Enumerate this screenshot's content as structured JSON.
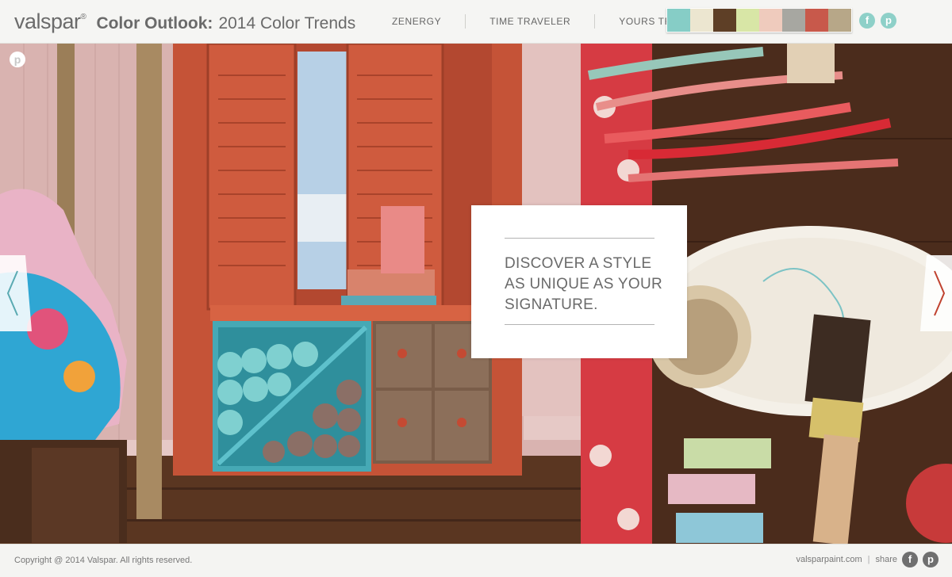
{
  "header": {
    "logo_brand": "valspar",
    "logo_mark": "®",
    "title_bold": "Color Outlook:",
    "title_light": "2014 Color Trends",
    "nav": [
      "ZENERGY",
      "TIME TRAVELER",
      "YOURS TRULY"
    ],
    "palette": [
      "#86cdc6",
      "#ece6d0",
      "#5e3f26",
      "#d8e6a6",
      "#efcbbd",
      "#a7a7a1",
      "#c8594b",
      "#b7a788"
    ],
    "social_icon_color": "#8ed0c8"
  },
  "hero": {
    "callout_text": "DISCOVER A STYLE AS UNIQUE AS YOUR SIGNATURE.",
    "prev_icon": "chevron-left-icon",
    "next_icon": "chevron-right-icon"
  },
  "footer": {
    "copyright": "Copyright @ 2014 Valspar. All rights reserved.",
    "site": "valsparpaint.com",
    "separator": "|",
    "share": "share"
  }
}
